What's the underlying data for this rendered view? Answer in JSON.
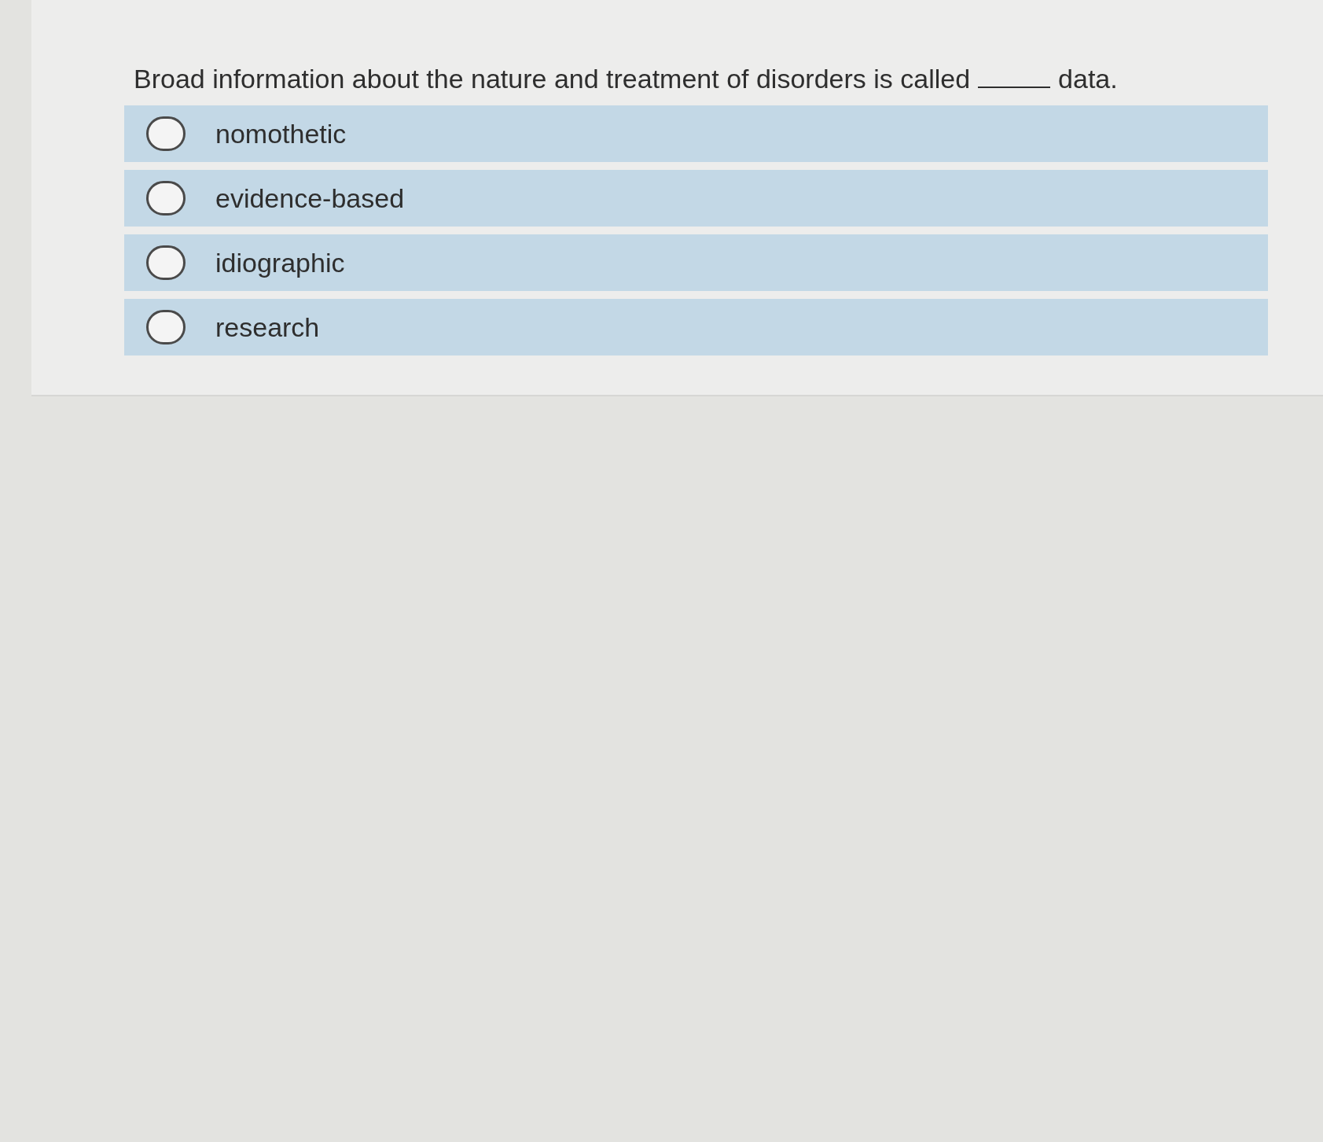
{
  "question": {
    "segments": [
      {
        "kind": "text",
        "text": "Broad information about the nature and treatment of disorders is called"
      },
      {
        "kind": "blank"
      },
      {
        "kind": "text",
        "text": "data."
      }
    ]
  },
  "options": [
    {
      "label": "nomothetic",
      "selected": false
    },
    {
      "label": "evidence-based",
      "selected": false
    },
    {
      "label": "idiographic",
      "selected": false
    },
    {
      "label": "research",
      "selected": false
    }
  ]
}
